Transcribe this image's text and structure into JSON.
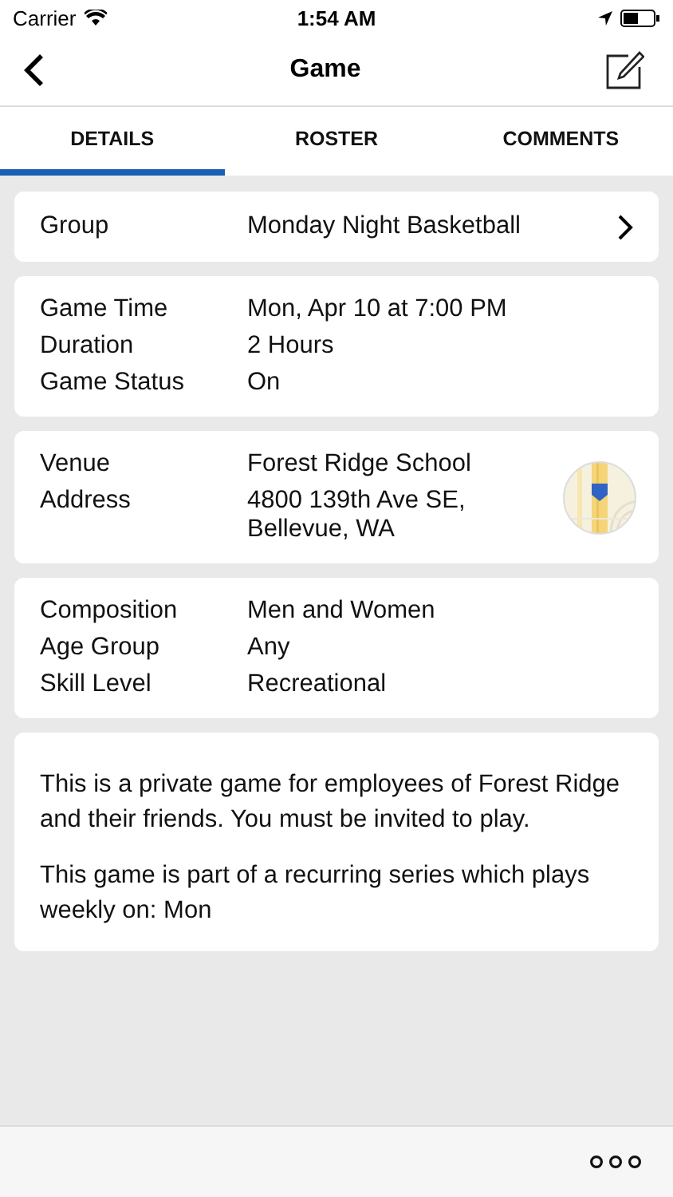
{
  "status_bar": {
    "carrier": "Carrier",
    "time": "1:54 AM"
  },
  "nav": {
    "title": "Game"
  },
  "tabs": [
    {
      "label": "DETAILS",
      "selected": true
    },
    {
      "label": "ROSTER",
      "selected": false
    },
    {
      "label": "COMMENTS",
      "selected": false
    }
  ],
  "sections": [
    {
      "kind": "link",
      "rows": [
        {
          "label": "Group",
          "value": "Monday Night Basketball"
        }
      ]
    },
    {
      "kind": "rows",
      "rows": [
        {
          "label": "Game Time",
          "value": "Mon, Apr 10 at 7:00 PM"
        },
        {
          "label": "Duration",
          "value": "2 Hours"
        },
        {
          "label": "Game Status",
          "value": "On"
        }
      ]
    },
    {
      "kind": "map",
      "rows": [
        {
          "label": "Venue",
          "value": "Forest Ridge School"
        },
        {
          "label": "Address",
          "value": "4800 139th Ave SE, Bellevue, WA"
        }
      ]
    },
    {
      "kind": "rows",
      "rows": [
        {
          "label": "Composition",
          "value": "Men and Women"
        },
        {
          "label": "Age Group",
          "value": "Any"
        },
        {
          "label": "Skill Level",
          "value": "Recreational"
        }
      ]
    },
    {
      "kind": "text",
      "paragraphs": [
        "This is a private game for employees of Forest Ridge and their friends. You must be invited to play.",
        "This game is part of a recurring series which plays weekly on: Mon"
      ]
    }
  ]
}
